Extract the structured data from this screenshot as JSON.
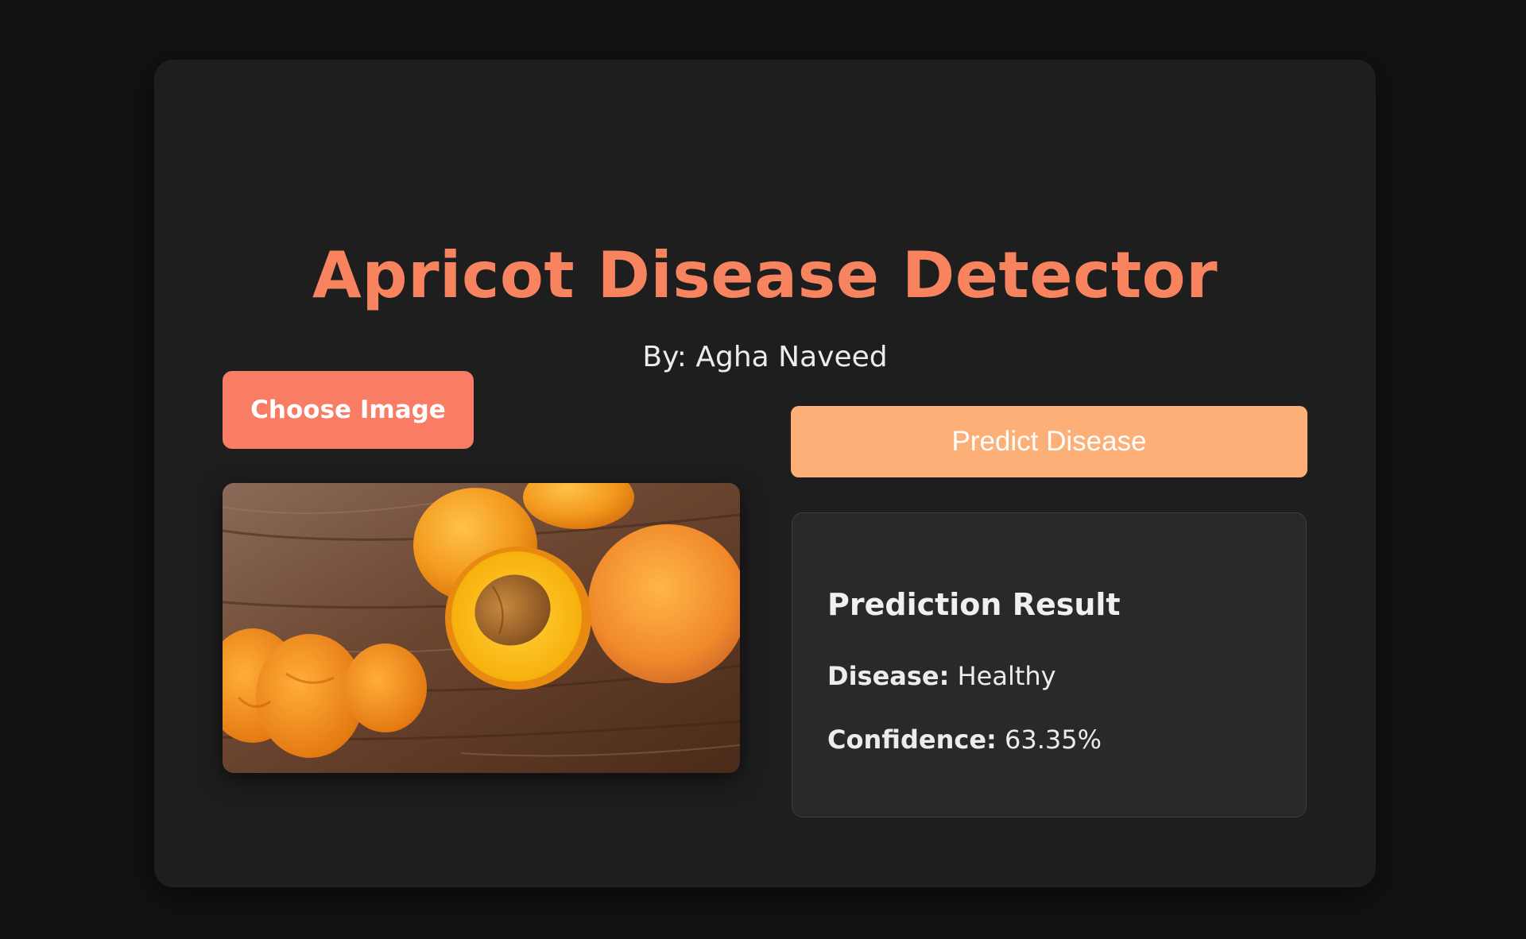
{
  "header": {
    "title": "Apricot Disease Detector",
    "subtitle": "By: Agha Naveed"
  },
  "upload": {
    "choose_label": "Choose Image"
  },
  "actions": {
    "predict_label": "Predict Disease"
  },
  "result": {
    "heading": "Prediction Result",
    "disease_label": "Disease:",
    "disease_value": "Healthy",
    "confidence_label": "Confidence:",
    "confidence_value": "63.35%"
  },
  "theme": {
    "background": "#121212",
    "card": "#1e1e1e",
    "accent_title": "#f7845e",
    "choose_button": "#f97c64",
    "predict_button": "#fdaf78",
    "result_panel": "#292929"
  },
  "image": {
    "icon": "apricot-photo"
  }
}
